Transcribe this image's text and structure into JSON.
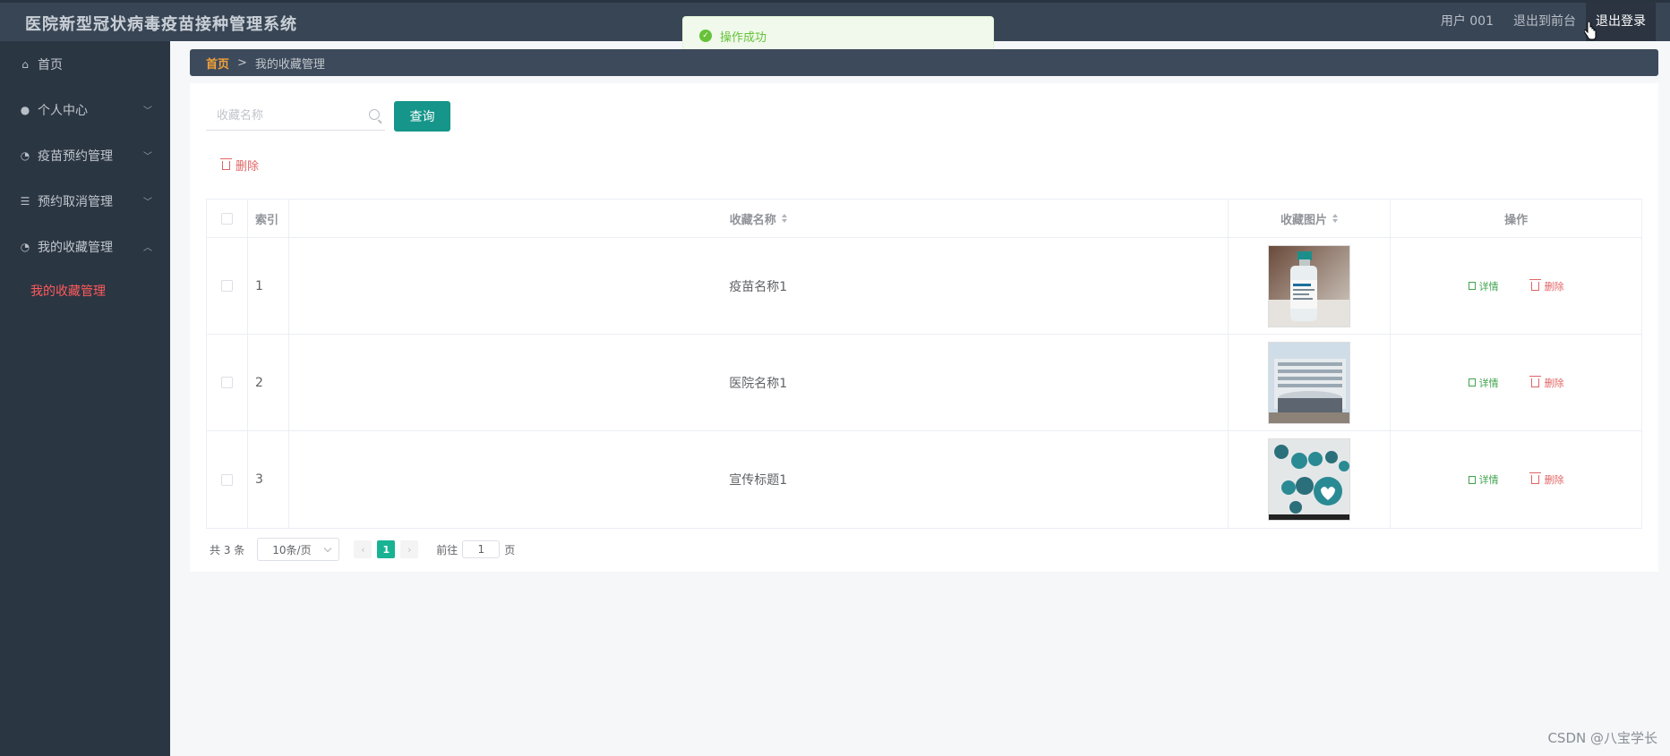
{
  "app": {
    "title": "医院新型冠状病毒疫苗接种管理系统"
  },
  "header": {
    "user": "用户 001",
    "to_front": "退出到前台",
    "logout": "退出登录"
  },
  "toast": {
    "message": "操作成功",
    "icon": "check-circle-icon",
    "color": "#67c23a"
  },
  "sidebar": {
    "items": [
      {
        "label": "首页",
        "icon": "home-icon"
      },
      {
        "label": "个人中心",
        "icon": "user-icon",
        "expandable": true
      },
      {
        "label": "疫苗预约管理",
        "icon": "dashboard-icon",
        "expandable": true
      },
      {
        "label": "预约取消管理",
        "icon": "list-icon",
        "expandable": true
      },
      {
        "label": "我的收藏管理",
        "icon": "dashboard-icon",
        "expandable": true,
        "expanded": true
      }
    ],
    "active_sub": "我的收藏管理"
  },
  "breadcrumb": {
    "home": "首页",
    "separator": ">",
    "current": "我的收藏管理"
  },
  "search": {
    "placeholder": "收藏名称",
    "button": "查询"
  },
  "actions": {
    "delete": "删除"
  },
  "table": {
    "columns": {
      "index": "索引",
      "name": "收藏名称",
      "image": "收藏图片",
      "ops": "操作"
    },
    "rows": [
      {
        "index": "1",
        "name": "疫苗名称1",
        "image": "vaccine-bottle-photo"
      },
      {
        "index": "2",
        "name": "医院名称1",
        "image": "hospital-building-photo"
      },
      {
        "index": "3",
        "name": "宣传标题1",
        "image": "medical-icons-photo"
      }
    ],
    "op_detail": "详情",
    "op_delete": "删除"
  },
  "pagination": {
    "total": "共 3 条",
    "page_size": "10条/页",
    "current": "1",
    "goto_prefix": "前往",
    "goto_value": "1",
    "goto_suffix": "页"
  },
  "watermark": "CSDN @八宝学长",
  "colors": {
    "primary": "#16958a",
    "accent": "#f2a23b",
    "danger": "#e06464",
    "success": "#3fa34d"
  }
}
